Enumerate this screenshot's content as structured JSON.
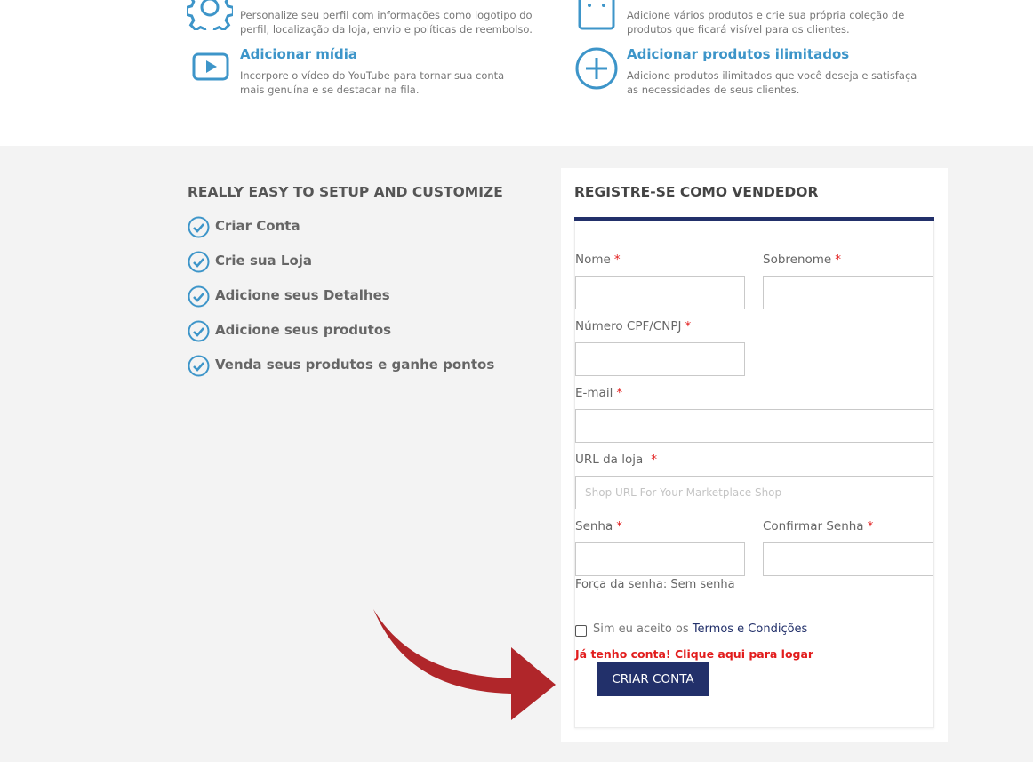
{
  "features": [
    {
      "icon": "gear-icon",
      "title": "",
      "desc_lines": [
        "Personalize seu perfil com informações como logotipo do",
        "perfil, localização da loja, envio e políticas de reembolso."
      ]
    },
    {
      "icon": "shopping-bag-icon",
      "title": "",
      "desc_lines": [
        "Adicione vários produtos e crie sua própria coleção de",
        "produtos que ficará visível para os clientes."
      ]
    },
    {
      "icon": "video-play-icon",
      "title": "Adicionar mídia",
      "desc_lines": [
        "Incorpore o vídeo do YouTube para tornar sua conta",
        "mais genuína e se destacar na fila."
      ]
    },
    {
      "icon": "plus-circle-icon",
      "title": "Adicionar produtos ilimitados",
      "desc_lines": [
        "Adicione produtos ilimitados que você deseja e satisfaça",
        "as necessidades de seus clientes."
      ]
    }
  ],
  "steps": {
    "title": "REALLY EASY TO SETUP AND CUSTOMIZE",
    "items": [
      "Criar Conta",
      "Crie sua Loja",
      "Adicione seus Detalhes",
      "Adicione seus produtos",
      "Venda seus produtos e ganhe pontos"
    ]
  },
  "form": {
    "title": "REGISTRE-SE COMO VENDEDOR",
    "required_mark": "*",
    "first_name_label": "Nome",
    "last_name_label": "Sobrenome",
    "cpf_label": "Número CPF/CNPJ",
    "email_label": "E-mail",
    "shop_url_label": "URL da loja",
    "shop_url_placeholder": "Shop URL For Your Marketplace Shop",
    "password_label": "Senha",
    "confirm_password_label": "Confirmar Senha",
    "strength_text": "Força da senha: Sem senha",
    "terms_prefix": "Sim eu aceito os",
    "terms_link": "Termos e Condições",
    "login_link": "Já tenho conta! Clique aqui para logar",
    "submit_label": "CRIAR CONTA"
  },
  "colors": {
    "accent_blue": "#3d95c9",
    "navy": "#22306a",
    "required_red": "#e21d1d",
    "arrow_red": "#b0262a",
    "section_gray": "#f3f3f3"
  }
}
